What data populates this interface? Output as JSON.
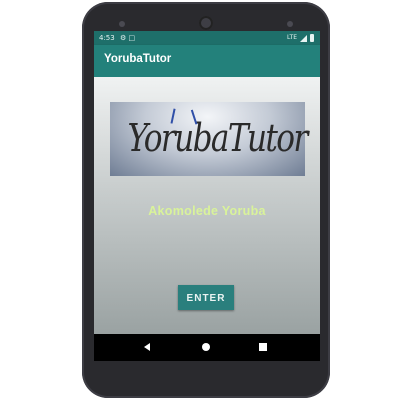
{
  "status_bar": {
    "time": "4:53",
    "left_icons": "⚙ □",
    "network": "LTE"
  },
  "app_bar": {
    "title": "YorubaTutor"
  },
  "logo": {
    "text": "YorubaTutor",
    "accent_color": "#2f4fa8"
  },
  "main": {
    "subtitle": "Akomolede Yoruba",
    "enter_label": "ENTER"
  },
  "nav_bar": {
    "icons": [
      "back-icon",
      "home-icon",
      "recent-apps-icon"
    ]
  },
  "colors": {
    "primary": "#23817b",
    "primary_dark": "#1e6f6a",
    "subtitle": "#d9f39a",
    "button": "#2a7f7d"
  }
}
